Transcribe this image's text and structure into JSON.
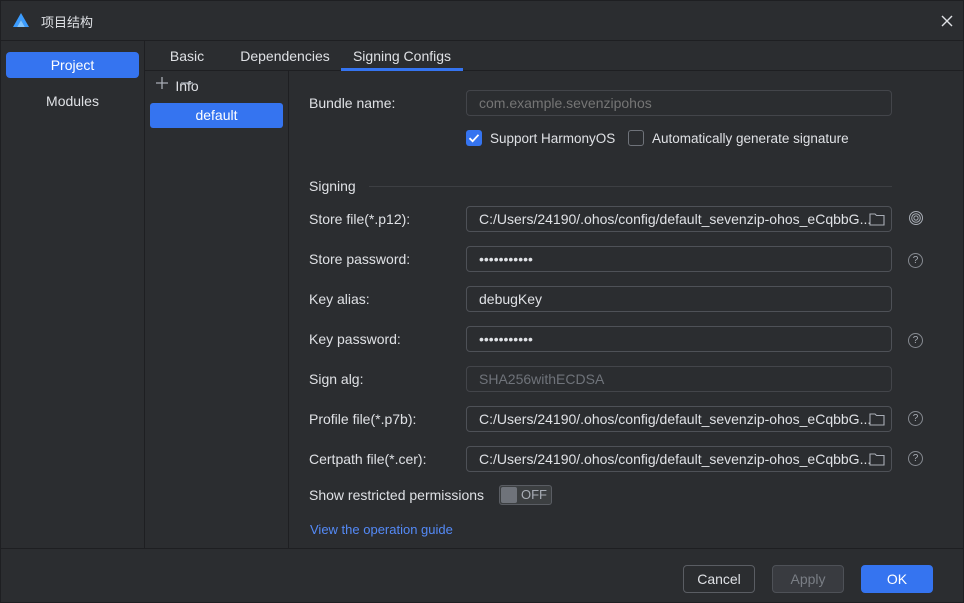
{
  "window": {
    "title": "项目结构"
  },
  "sidebar": {
    "items": [
      {
        "label": "Project",
        "active": true
      },
      {
        "label": "Modules",
        "active": false
      }
    ]
  },
  "tabs": [
    {
      "label": "Basic Info",
      "active": false
    },
    {
      "label": "Dependencies",
      "active": false
    },
    {
      "label": "Signing Configs",
      "active": true
    }
  ],
  "config_list": {
    "add_glyph": "+",
    "remove_glyph": "−",
    "items": [
      "default"
    ]
  },
  "form": {
    "bundle_name": {
      "label": "Bundle name:",
      "placeholder": "com.example.sevenzipohos"
    },
    "support_harmonyos": {
      "label": "Support HarmonyOS",
      "checked": true
    },
    "auto_signature": {
      "label": "Automatically generate signature",
      "checked": false
    },
    "signing_section": "Signing",
    "store_file": {
      "label": "Store file(*.p12):",
      "value": "C:/Users/24190/.ohos/config/default_sevenzip-ohos_eCqbbG..."
    },
    "store_password": {
      "label": "Store password:",
      "value": "•••••••••••"
    },
    "key_alias": {
      "label": "Key alias:",
      "value": "debugKey"
    },
    "key_password": {
      "label": "Key password:",
      "value": "•••••••••••"
    },
    "sign_alg": {
      "label": "Sign alg:",
      "value": "SHA256withECDSA"
    },
    "profile_file": {
      "label": "Profile file(*.p7b):",
      "value": "C:/Users/24190/.ohos/config/default_sevenzip-ohos_eCqbbG..."
    },
    "certpath_file": {
      "label": "Certpath file(*.cer):",
      "value": "C:/Users/24190/.ohos/config/default_sevenzip-ohos_eCqbbG..."
    },
    "restricted_permissions": {
      "label": "Show restricted permissions",
      "toggle_text": "OFF",
      "enabled": false
    },
    "help_glyph": "?",
    "guide_link": "View the operation guide"
  },
  "buttons": {
    "cancel": "Cancel",
    "apply": "Apply",
    "ok": "OK"
  },
  "colors": {
    "accent": "#3574f0",
    "background": "#2b2d30",
    "link": "#548af7"
  }
}
